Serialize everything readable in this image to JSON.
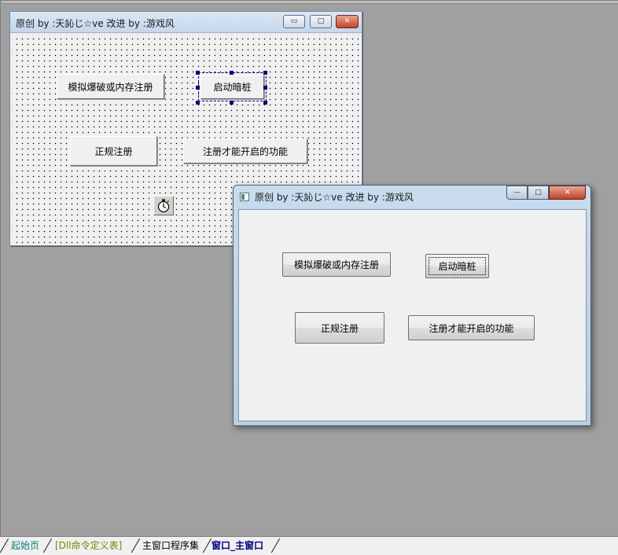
{
  "design_form": {
    "title": "原创 by :天訫じ☆ve  改进 by :游戏风",
    "min_glyph": "▭",
    "max_glyph": "□",
    "close_glyph": "✕",
    "buttons": {
      "simulate_crack": "模拟爆破或内存注册",
      "start_hidden": "启动暗桩",
      "formal_register": "正规注册",
      "registered_feature": "注册才能开启的功能"
    },
    "timer_icon": "stopwatch-icon"
  },
  "preview_window": {
    "title": "原创 by :天訫じ☆ve  改进 by :游戏风",
    "min_glyph": "—",
    "max_glyph": "□",
    "close_glyph": "✕",
    "buttons": {
      "simulate_crack": "模拟爆破或内存注册",
      "start_hidden": "启动暗桩",
      "formal_register": "正规注册",
      "registered_feature": "注册才能开启的功能"
    }
  },
  "tabs": [
    {
      "label": "起始页",
      "color": "#008080"
    },
    {
      "label": "[Dll命令定义表]",
      "color": "#808000"
    },
    {
      "label": "主窗口程序集",
      "color": "#000000"
    },
    {
      "label": "窗口_主窗口",
      "color": "#000080",
      "active": true
    }
  ]
}
